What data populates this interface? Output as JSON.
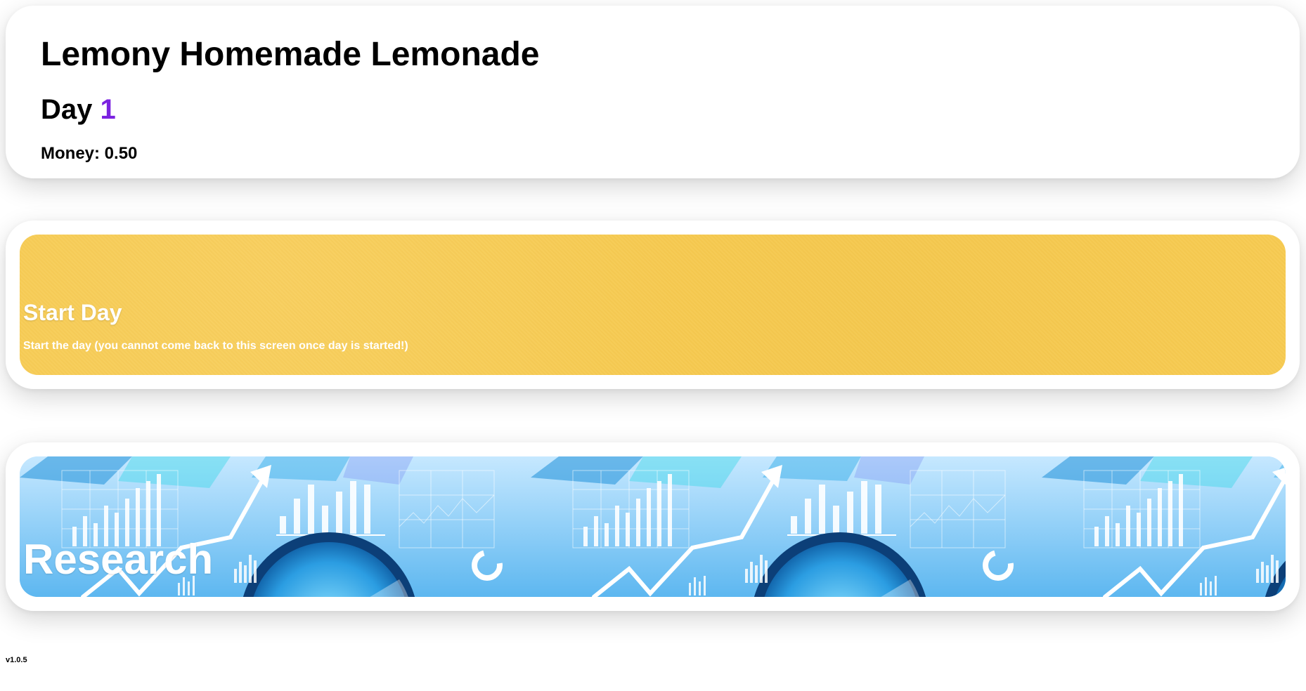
{
  "header": {
    "title": "Lemony Homemade Lemonade",
    "day_label": "Day",
    "day_number": "1",
    "money_label": "Money:",
    "money_value": "0.50"
  },
  "start_day": {
    "title": "Start Day",
    "description": "Start the day (you cannot come back to this screen once day is started!)",
    "background_color": "#f7cb52"
  },
  "research": {
    "title": "Research",
    "background_art": "analytics-charts-magnifier-pattern"
  },
  "colors": {
    "day_number": "#7b22e0",
    "research_blue": "#78c6f7"
  },
  "footer": {
    "version": "v1.0.5"
  }
}
